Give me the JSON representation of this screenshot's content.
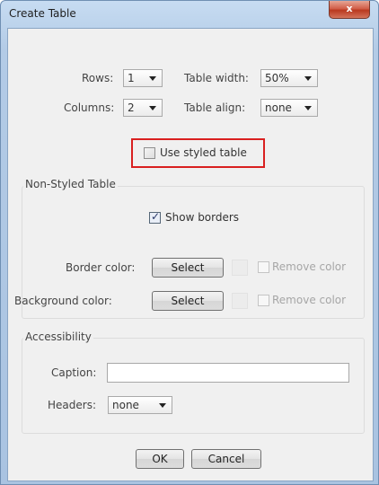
{
  "window": {
    "title": "Create Table",
    "close_glyph": "x"
  },
  "size": {
    "rows_label": "Rows:",
    "rows_value": "1",
    "columns_label": "Columns:",
    "columns_value": "2",
    "table_width_label": "Table width:",
    "table_width_value": "50%",
    "table_align_label": "Table align:",
    "table_align_value": "none"
  },
  "styled": {
    "use_styled_label": "Use styled table",
    "checked": false
  },
  "non_styled": {
    "group_title": "Non-Styled Table",
    "show_borders_label": "Show borders",
    "show_borders_checked": true,
    "border_color_label": "Border color:",
    "background_color_label": "Background color:",
    "select_label": "Select",
    "remove_color_label": "Remove color"
  },
  "accessibility": {
    "group_title": "Accessibility",
    "caption_label": "Caption:",
    "caption_value": "",
    "headers_label": "Headers:",
    "headers_value": "none"
  },
  "footer": {
    "ok_label": "OK",
    "cancel_label": "Cancel"
  },
  "colors": {
    "highlight_border": "#d92020",
    "title_bar": "#b3cbe6",
    "close_button": "#c8432a"
  }
}
